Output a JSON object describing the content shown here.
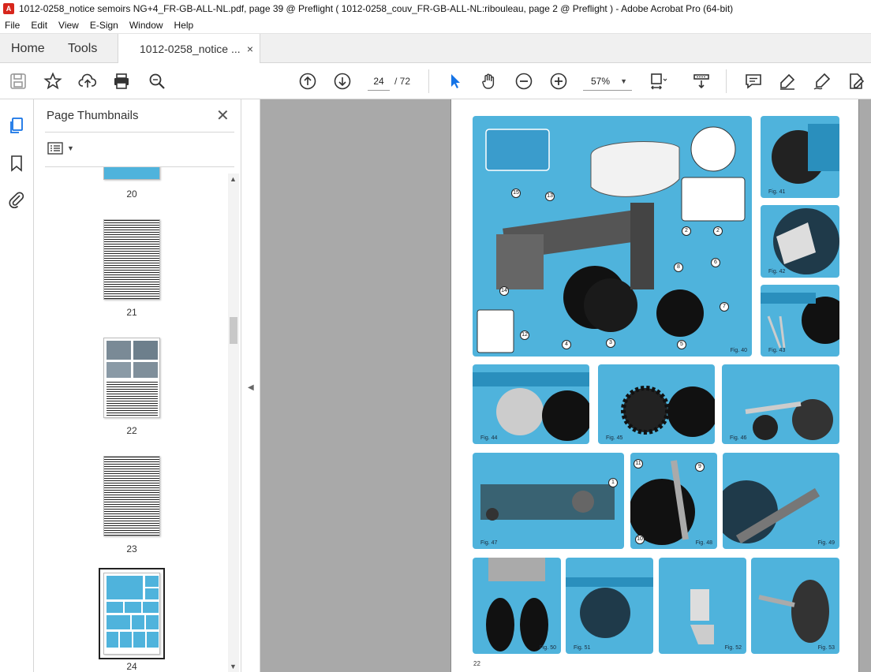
{
  "window": {
    "title": "1012-0258_notice semoirs NG+4_FR-GB-ALL-NL.pdf, page 39 @ Preflight ( 1012-0258_couv_FR-GB-ALL-NL:ribouleau, page 2 @ Preflight ) - Adobe Acrobat Pro (64-bit)",
    "app_icon": "acrobat-icon"
  },
  "menubar": {
    "items": [
      "File",
      "Edit",
      "View",
      "E-Sign",
      "Window",
      "Help"
    ]
  },
  "tabs": {
    "home": "Home",
    "tools": "Tools",
    "document": "1012-0258_notice ...",
    "close": "×"
  },
  "toolbar": {
    "current_page": "24",
    "total_pages": "/ 72",
    "zoom": "57%",
    "icons": [
      "save-icon",
      "bookmark-star-icon",
      "upload-cloud-icon",
      "print-icon",
      "search-zoom-icon",
      "page-up-icon",
      "page-down-icon",
      "select-cursor-icon",
      "hand-icon",
      "zoom-out-icon",
      "zoom-in-icon",
      "fit-page-icon",
      "scroll-mode-icon",
      "comment-icon",
      "highlight-icon",
      "sign-icon",
      "edit-pdf-icon"
    ]
  },
  "leftrail": {
    "icons": [
      "page-thumbnails-icon",
      "bookmarks-icon",
      "attachments-icon"
    ]
  },
  "thumbnails_panel": {
    "title": "Page Thumbnails",
    "close": "✕",
    "pages": [
      {
        "label": "20"
      },
      {
        "label": "21"
      },
      {
        "label": "22"
      },
      {
        "label": "23"
      },
      {
        "label": "24",
        "selected": true
      }
    ]
  },
  "document_page": {
    "page_number": "22",
    "figures": [
      {
        "label": "Fig. 40"
      },
      {
        "label": "Fig. 41"
      },
      {
        "label": "Fig. 42"
      },
      {
        "label": "Fig. 43"
      },
      {
        "label": "Fig. 44"
      },
      {
        "label": "Fig. 45"
      },
      {
        "label": "Fig. 46"
      },
      {
        "label": "Fig. 47"
      },
      {
        "label": "Fig. 48"
      },
      {
        "label": "Fig. 49"
      },
      {
        "label": "Fig. 50"
      },
      {
        "label": "Fig. 51"
      },
      {
        "label": "Fig. 52"
      },
      {
        "label": "Fig. 53"
      }
    ],
    "callouts": [
      "15",
      "13",
      "2",
      "2",
      "8",
      "6",
      "7",
      "14",
      "12",
      "4",
      "3",
      "5",
      "1",
      "11",
      "9",
      "10"
    ]
  },
  "colors": {
    "figure_background": "#4fb3dc",
    "viewer_background": "#a9a9a9",
    "accent_blue": "#1473e6"
  }
}
